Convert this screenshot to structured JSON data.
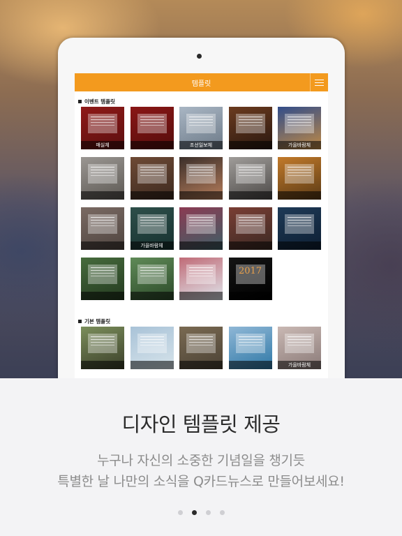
{
  "app": {
    "title": "템플릿"
  },
  "sections": {
    "event": {
      "title": "이벤트 템플릿",
      "items": [
        {
          "label": "매실체",
          "color": "#8f1a18",
          "color2": "#5b0f0f"
        },
        {
          "label": "",
          "color": "#8a1716",
          "color2": "#550d0c"
        },
        {
          "label": "조선일보체",
          "color": "#a9b6c4",
          "color2": "#6d7a88"
        },
        {
          "label": "",
          "color": "#6b3b1f",
          "color2": "#2a1810"
        },
        {
          "label": "가을바람체",
          "color": "#324d8a",
          "color2": "#c08a45"
        },
        {
          "label": "",
          "color": "#9a9692",
          "color2": "#5d5954"
        },
        {
          "label": "",
          "color": "#6e4a35",
          "color2": "#3d2a20"
        },
        {
          "label": "",
          "color": "#3b2f2a",
          "color2": "#b67d5b"
        },
        {
          "label": "",
          "color": "#9f9c99",
          "color2": "#4d4a48"
        },
        {
          "label": "",
          "color": "#c27a2a",
          "color2": "#5a3a16"
        },
        {
          "label": "",
          "color": "#7a6a63",
          "color2": "#4f4540"
        },
        {
          "label": "가을바람체",
          "color": "#2e4f4a",
          "color2": "#173230"
        },
        {
          "label": "",
          "color": "#8b3b53",
          "color2": "#3f5f66"
        },
        {
          "label": "",
          "color": "#7a3e34",
          "color2": "#3b2a24"
        },
        {
          "label": "",
          "color": "#1e3a57",
          "color2": "#0e1f33"
        },
        {
          "label": "",
          "color": "#466b3c",
          "color2": "#243a20"
        },
        {
          "label": "",
          "color": "#5f8a57",
          "color2": "#2c4a2a"
        },
        {
          "label": "",
          "color": "#c06b77",
          "color2": "#dfe4ea"
        },
        {
          "label": "",
          "color": "#141414",
          "color2": "#000000",
          "big": "2017"
        }
      ]
    },
    "basic": {
      "title": "기본 템플릿",
      "items": [
        {
          "label": "",
          "color": "#7b8e5b",
          "color2": "#3b3f2a"
        },
        {
          "label": "",
          "color": "#a9c3d8",
          "color2": "#d6e3ea"
        },
        {
          "label": "",
          "color": "#7a6a52",
          "color2": "#4b4235"
        },
        {
          "label": "",
          "color": "#8fb7d6",
          "color2": "#2f78a6"
        },
        {
          "label": "가을바람체",
          "color": "#c9b8b3",
          "color2": "#8a7a78"
        }
      ]
    }
  },
  "headline": "디자인 템플릿 제공",
  "subtitle_line1": "누구나 자신의 소중한 기념일을 챙기듯",
  "subtitle_line2": "특별한 날 나만의 소식을 Q카드뉴스로 만들어보세요!",
  "pagination": {
    "total": 4,
    "active": 2
  }
}
